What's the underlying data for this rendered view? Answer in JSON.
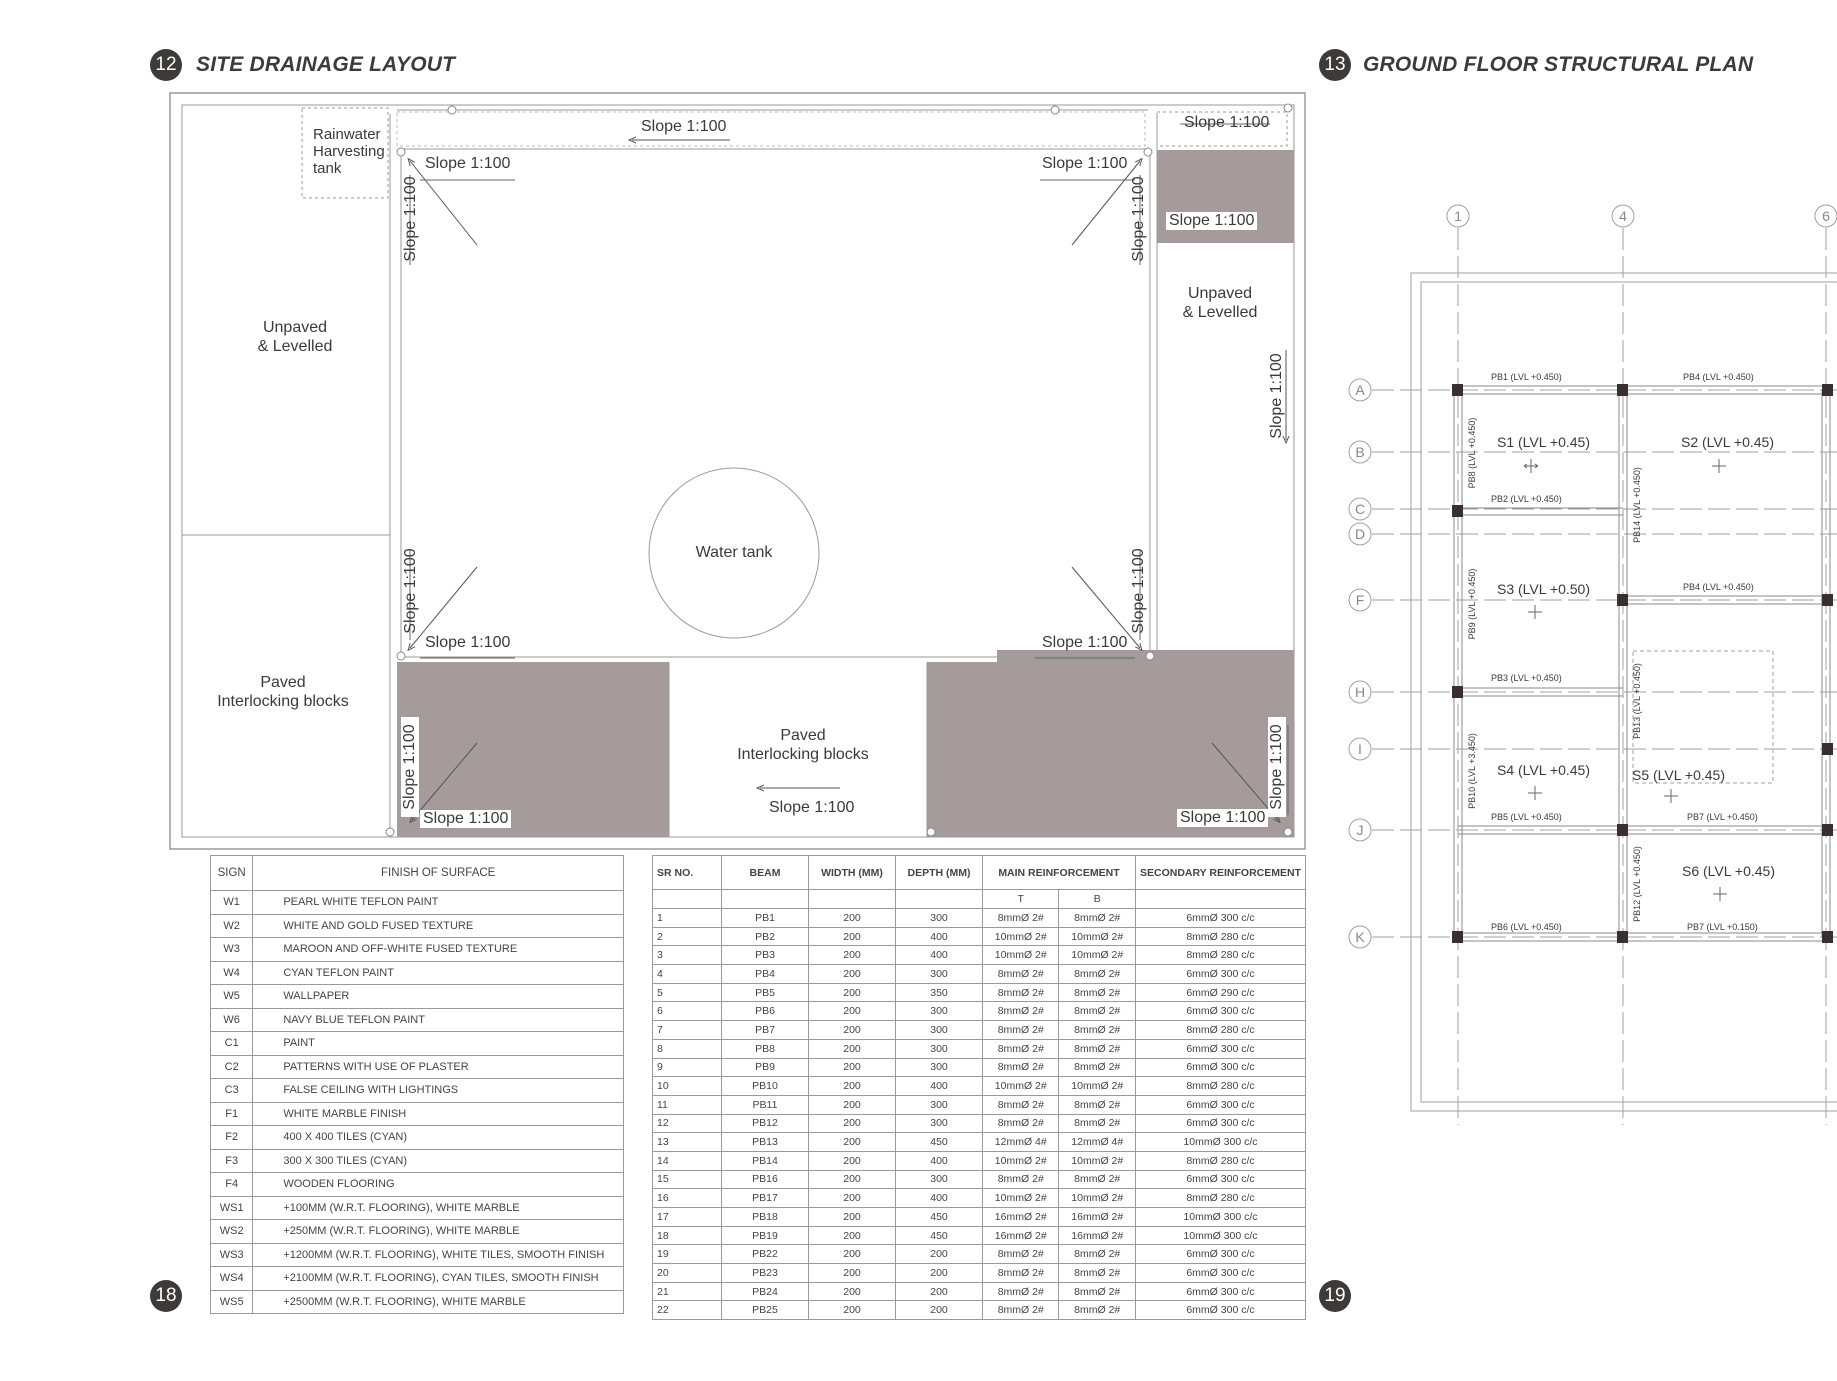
{
  "sections": {
    "site_drainage": {
      "number": "12",
      "title": "SITE DRAINAGE LAYOUT"
    },
    "ground_floor": {
      "number": "13",
      "title": "GROUND FLOOR STRUCTURAL PLAN"
    }
  },
  "page_numbers": {
    "left": "18",
    "right": "19"
  },
  "drainage": {
    "rainwater": [
      "Rainwater",
      "Harvesting",
      "tank"
    ],
    "slope": "Slope 1:100",
    "unpaved": [
      "Unpaved",
      "& Levelled"
    ],
    "paved": [
      "Paved",
      "Interlocking blocks"
    ],
    "water_tank": "Water tank"
  },
  "structural": {
    "column_grid": [
      "1",
      "4",
      "6"
    ],
    "row_grid": [
      "A",
      "B",
      "C",
      "D",
      "F",
      "H",
      "I",
      "J",
      "K"
    ],
    "slabs": [
      "S1 (LVL +0.45)",
      "S2 (LVL +0.45)",
      "S3 (LVL +0.50)",
      "S4 (LVL +0.45)",
      "S5 (LVL +0.45)",
      "S6 (LVL +0.45)"
    ],
    "beams": {
      "pb1": "PB1  (LVL +0.450)",
      "pb4a": "PB4 (LVL +0.450)",
      "pb2": "PB2 (LVL +0.450)",
      "pb4b": "PB4 (LVL +0.450)",
      "pb3": "PB3 (LVL +0.450)",
      "pb5": "PB5 (LVL +0.450)",
      "pb7a": "PB7 (LVL +0.450)",
      "pb6": "PB6 (LVL +0.450)",
      "pb7b": "PB7 (LVL +0.150)",
      "pb8": "PB8 (LVL +0.450)",
      "pb9": "PB9 (LVL +0.450)",
      "pb10": "PB10 (LVL +3.450)",
      "pb12": "PB12 (LVL +0.450)",
      "pb13": "PB13 (LVL +0.450)",
      "pb14": "PB14 (LVL +0.450)"
    }
  },
  "finish_table": {
    "headers": [
      "SIGN",
      "FINISH OF SURFACE"
    ],
    "rows": [
      [
        "W1",
        "PEARL WHITE TEFLON PAINT"
      ],
      [
        "W2",
        "WHITE AND GOLD FUSED TEXTURE"
      ],
      [
        "W3",
        "MAROON AND OFF-WHITE FUSED TEXTURE"
      ],
      [
        "W4",
        "CYAN TEFLON PAINT"
      ],
      [
        "W5",
        "WALLPAPER"
      ],
      [
        "W6",
        "NAVY BLUE TEFLON PAINT"
      ],
      [
        "C1",
        "PAINT"
      ],
      [
        "C2",
        "PATTERNS WITH USE OF PLASTER"
      ],
      [
        "C3",
        "FALSE CEILING WITH LIGHTINGS"
      ],
      [
        "F1",
        "WHITE MARBLE FINISH"
      ],
      [
        "F2",
        "400 X 400 TILES (CYAN)"
      ],
      [
        "F3",
        "300 X 300 TILES (CYAN)"
      ],
      [
        "F4",
        "WOODEN FLOORING"
      ],
      [
        "WS1",
        "+100MM (W.R.T. FLOORING), WHITE MARBLE"
      ],
      [
        "WS2",
        "+250MM (W.R.T. FLOORING), WHITE MARBLE"
      ],
      [
        "WS3",
        "+1200MM (W.R.T. FLOORING), WHITE TILES, SMOOTH FINISH"
      ],
      [
        "WS4",
        "+2100MM (W.R.T. FLOORING), CYAN TILES, SMOOTH FINISH"
      ],
      [
        "WS5",
        "+2500MM (W.R.T. FLOORING), WHITE MARBLE"
      ]
    ]
  },
  "beam_table": {
    "headers": [
      "SR NO.",
      "BEAM",
      "WIDTH (MM)",
      "DEPTH (MM)",
      "MAIN REINFORCEMENT",
      "SECONDARY REINFORCEMENT"
    ],
    "sub_headers": [
      "T",
      "B"
    ],
    "rows": [
      [
        "1",
        "PB1",
        "200",
        "300",
        "8mmØ 2#",
        "8mmØ 2#",
        "6mmØ 300 c/c"
      ],
      [
        "2",
        "PB2",
        "200",
        "400",
        "10mmØ 2#",
        "10mmØ 2#",
        "8mmØ 280 c/c"
      ],
      [
        "3",
        "PB3",
        "200",
        "400",
        "10mmØ 2#",
        "10mmØ 2#",
        "8mmØ 280 c/c"
      ],
      [
        "4",
        "PB4",
        "200",
        "300",
        "8mmØ 2#",
        "8mmØ 2#",
        "6mmØ 300 c/c"
      ],
      [
        "5",
        "PB5",
        "200",
        "350",
        "8mmØ 2#",
        "8mmØ 2#",
        "6mmØ 290 c/c"
      ],
      [
        "6",
        "PB6",
        "200",
        "300",
        "8mmØ 2#",
        "8mmØ 2#",
        "6mmØ 300 c/c"
      ],
      [
        "7",
        "PB7",
        "200",
        "300",
        "8mmØ 2#",
        "8mmØ 2#",
        "8mmØ 280 c/c"
      ],
      [
        "8",
        "PB8",
        "200",
        "300",
        "8mmØ 2#",
        "8mmØ 2#",
        "6mmØ 300 c/c"
      ],
      [
        "9",
        "PB9",
        "200",
        "300",
        "8mmØ 2#",
        "8mmØ 2#",
        "6mmØ 300 c/c"
      ],
      [
        "10",
        "PB10",
        "200",
        "400",
        "10mmØ 2#",
        "10mmØ 2#",
        "8mmØ 280 c/c"
      ],
      [
        "11",
        "PB11",
        "200",
        "300",
        "8mmØ 2#",
        "8mmØ 2#",
        "6mmØ 300 c/c"
      ],
      [
        "12",
        "PB12",
        "200",
        "300",
        "8mmØ 2#",
        "8mmØ 2#",
        "6mmØ 300 c/c"
      ],
      [
        "13",
        "PB13",
        "200",
        "450",
        "12mmØ 4#",
        "12mmØ 4#",
        "10mmØ 300 c/c"
      ],
      [
        "14",
        "PB14",
        "200",
        "400",
        "10mmØ 2#",
        "10mmØ 2#",
        "8mmØ 280 c/c"
      ],
      [
        "15",
        "PB16",
        "200",
        "300",
        "8mmØ 2#",
        "8mmØ 2#",
        "6mmØ 300 c/c"
      ],
      [
        "16",
        "PB17",
        "200",
        "400",
        "10mmØ 2#",
        "10mmØ 2#",
        "8mmØ 280 c/c"
      ],
      [
        "17",
        "PB18",
        "200",
        "450",
        "16mmØ 2#",
        "16mmØ 2#",
        "10mmØ 300 c/c"
      ],
      [
        "18",
        "PB19",
        "200",
        "450",
        "16mmØ 2#",
        "16mmØ 2#",
        "10mmØ 300 c/c"
      ],
      [
        "19",
        "PB22",
        "200",
        "200",
        "8mmØ 2#",
        "8mmØ 2#",
        "6mmØ 300 c/c"
      ],
      [
        "20",
        "PB23",
        "200",
        "200",
        "8mmØ 2#",
        "8mmØ 2#",
        "6mmØ 300 c/c"
      ],
      [
        "21",
        "PB24",
        "200",
        "200",
        "8mmØ 2#",
        "8mmØ 2#",
        "6mmØ 300 c/c"
      ],
      [
        "22",
        "PB25",
        "200",
        "200",
        "8mmØ 2#",
        "8mmØ 2#",
        "6mmØ 300 c/c"
      ]
    ]
  },
  "colors": {
    "paved_fill": "#a59b9b",
    "ink": "#3e3a3a",
    "line": "#8a8a8a",
    "column": "#3a2f2f"
  }
}
